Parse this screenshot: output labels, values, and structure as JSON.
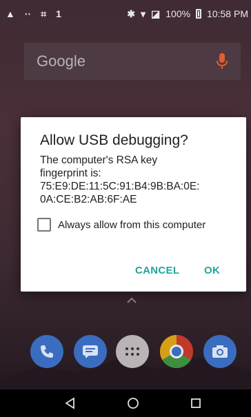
{
  "status_bar": {
    "battery": "100%",
    "time": "10:58 PM",
    "sim_slot": "1",
    "left_icons": [
      "alert-icon",
      "more-dots-icon",
      "scan-icon",
      "sim-1-label"
    ],
    "right_icons": [
      "bluetooth-icon",
      "wifi-icon",
      "no-sim-icon",
      "battery-icon"
    ]
  },
  "search": {
    "logo_text": "Google",
    "icon": "mic-icon"
  },
  "dialog": {
    "title": "Allow USB debugging?",
    "message": "The computer's RSA key\nfingerprint is:\n75:E9:DE:11:5C:91:B4:9B:BA:0E:\n0A:CE:B2:AB:6F:AE",
    "checkbox_label": "Always allow from this computer",
    "checkbox_checked": false,
    "cancel_label": "CANCEL",
    "ok_label": "OK",
    "accent_color": "#1ea59a"
  },
  "dock": {
    "apps": [
      "phone-icon",
      "messages-icon",
      "app-drawer-icon",
      "chrome-icon",
      "camera-icon"
    ]
  },
  "nav_bar": {
    "buttons": [
      "back-icon",
      "home-icon",
      "recents-icon"
    ]
  }
}
